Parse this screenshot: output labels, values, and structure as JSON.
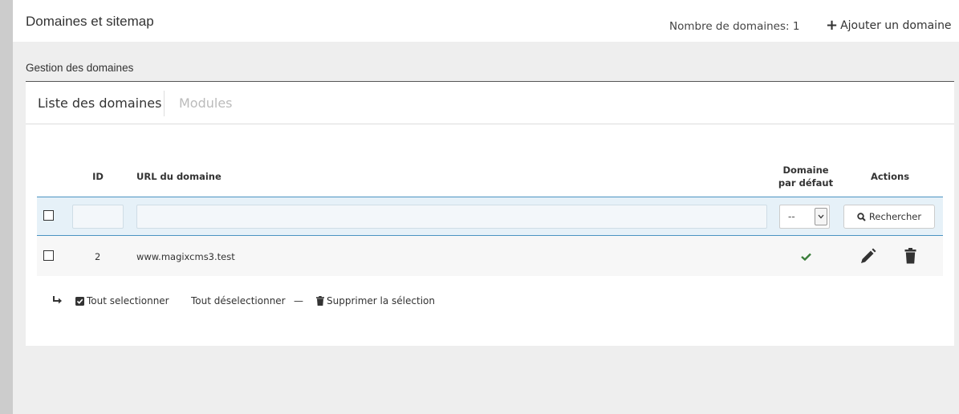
{
  "header": {
    "title": "Domaines et sitemap",
    "count_label": "Nombre de domaines: 1",
    "add_label": "Ajouter un domaine"
  },
  "section": {
    "title": "Gestion des domaines"
  },
  "tabs": [
    {
      "label": "Liste des domaines",
      "active": true
    },
    {
      "label": "Modules",
      "active": false
    }
  ],
  "table": {
    "columns": {
      "id": "ID",
      "url": "URL du domaine",
      "default_line1": "Domaine",
      "default_line2": "par défaut",
      "actions": "Actions"
    },
    "filters": {
      "id_value": "",
      "url_value": "",
      "default_selected": "--",
      "search_label": "Rechercher"
    },
    "rows": [
      {
        "id": "2",
        "url": "www.magixcms3.test",
        "is_default": true
      }
    ]
  },
  "bulk_actions": {
    "select_all": "Tout selectionner",
    "deselect_all": "Tout déselectionner",
    "separator": "—",
    "delete_selection": "Supprimer la sélection"
  },
  "colors": {
    "accent_blue": "#4a93c2",
    "filter_bg": "#e6f1f8",
    "check_green": "#3a7d3a"
  },
  "icons": [
    "plus-icon",
    "search-icon",
    "chevron-down-icon",
    "check-icon",
    "pencil-icon",
    "trash-icon",
    "reply-arrow-icon",
    "checked-square-icon"
  ]
}
